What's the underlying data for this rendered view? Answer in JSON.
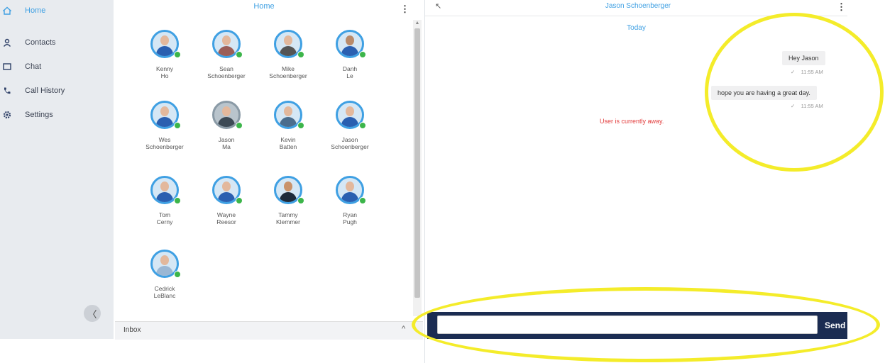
{
  "sidebar": {
    "items": [
      {
        "label": "Home",
        "icon": "home-icon",
        "active": true
      },
      {
        "label": "Contacts",
        "icon": "contacts-icon"
      },
      {
        "label": "Chat",
        "icon": "chat-icon"
      },
      {
        "label": "Call History",
        "icon": "phone-icon"
      },
      {
        "label": "Settings",
        "icon": "gear-icon"
      }
    ],
    "collapse_glyph": "〈"
  },
  "contacts_panel": {
    "title": "Home",
    "kebab": "⋮",
    "contacts": [
      {
        "first": "Kenny",
        "last": "Ho"
      },
      {
        "first": "Sean",
        "last": "Schoenberger"
      },
      {
        "first": "Mike",
        "last": "Schoenberger"
      },
      {
        "first": "Danh",
        "last": "Le"
      },
      {
        "first": "Wes",
        "last": "Schoenberger"
      },
      {
        "first": "Jason",
        "last": "Ma"
      },
      {
        "first": "Kevin",
        "last": "Batten"
      },
      {
        "first": "Jason",
        "last": "Schoenberger"
      },
      {
        "first": "Tom",
        "last": "Cerny"
      },
      {
        "first": "Wayne",
        "last": "Reesor"
      },
      {
        "first": "Tammy",
        "last": "Klemmer"
      },
      {
        "first": "Ryan",
        "last": "Pugh"
      },
      {
        "first": "Cedrick",
        "last": "LeBlanc"
      }
    ],
    "inbox_label": "Inbox",
    "inbox_toggle": "^"
  },
  "chat_panel": {
    "back_glyph": "↖",
    "title": "Jason Schoenberger",
    "kebab": "⋮",
    "date_separator": "Today",
    "messages": [
      {
        "text": "Hey Jason",
        "time": "11:55 AM",
        "check": "✓"
      },
      {
        "text": "hope you are having a great day.",
        "time": "11:55 AM",
        "check": "✓"
      }
    ],
    "away_status": "User is currently away.",
    "input_value": "",
    "send_label": "Send"
  },
  "colors": {
    "accent": "#3fa0e3",
    "presence_online": "#3cb54a",
    "away_red": "#e23b3b",
    "compose_bar": "#1b2c52",
    "highlight": "#f4ec2a"
  }
}
